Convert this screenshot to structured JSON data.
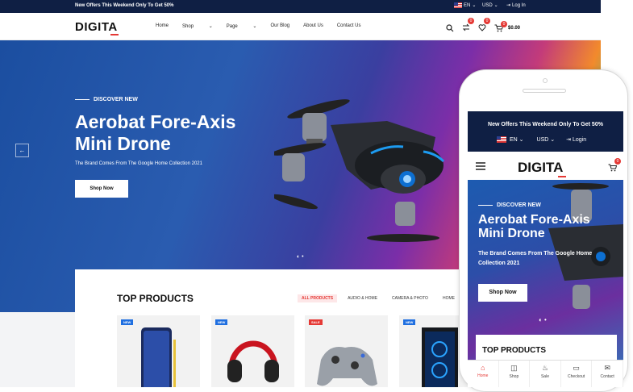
{
  "topbar": {
    "offer": "New Offers This Weekend Only To Get 50%",
    "language": "EN",
    "currency": "USD",
    "login": "Log In"
  },
  "header": {
    "logo": "DIGITA",
    "nav": [
      "Home",
      "Shop",
      "Page",
      "Our Blog",
      "About Us",
      "Contact Us"
    ],
    "wishlist_count": "0",
    "cart_count": "0",
    "cart_total": "$0.00"
  },
  "hero": {
    "eyebrow": "DISCOVER NEW",
    "title": "Aerobat Fore-Axis Mini Drone",
    "subtitle": "The Brand Comes From The Google Home Collection 2021",
    "cta": "Shop Now",
    "prev_arrow": "←"
  },
  "products": {
    "title": "TOP PRODUCTS",
    "tabs": [
      "ALL PRODUCTS",
      "AUDIO & HOME",
      "CAMERA & PHOTO",
      "HOME"
    ],
    "cards": [
      {
        "tag": "NEW",
        "tag_color": "#1f6fe0"
      },
      {
        "tag": "NEW",
        "tag_color": "#1f6fe0"
      },
      {
        "tag": "SALE",
        "tag_color": "#e53935"
      },
      {
        "tag": "NEW",
        "tag_color": "#1f6fe0"
      }
    ]
  },
  "mobile": {
    "offer": "New Offers This Weekend Only To Get 50%",
    "language": "EN",
    "currency": "USD",
    "login": "Login",
    "logo": "DIGITA",
    "cart_count": "0",
    "eyebrow": "DISCOVER NEW",
    "title": "Aerobat Fore-Axis Mini Drone",
    "subtitle": "The Brand Comes From The Google Home Collection 2021",
    "cta": "Shop Now",
    "products_title": "TOP PRODUCTS",
    "bottom_nav": [
      "Home",
      "Shop",
      "Sale",
      "Checkout",
      "Contact"
    ]
  },
  "colors": {
    "accent": "#e53935",
    "dark": "#0f1f44",
    "tag_new": "#1f6fe0"
  }
}
